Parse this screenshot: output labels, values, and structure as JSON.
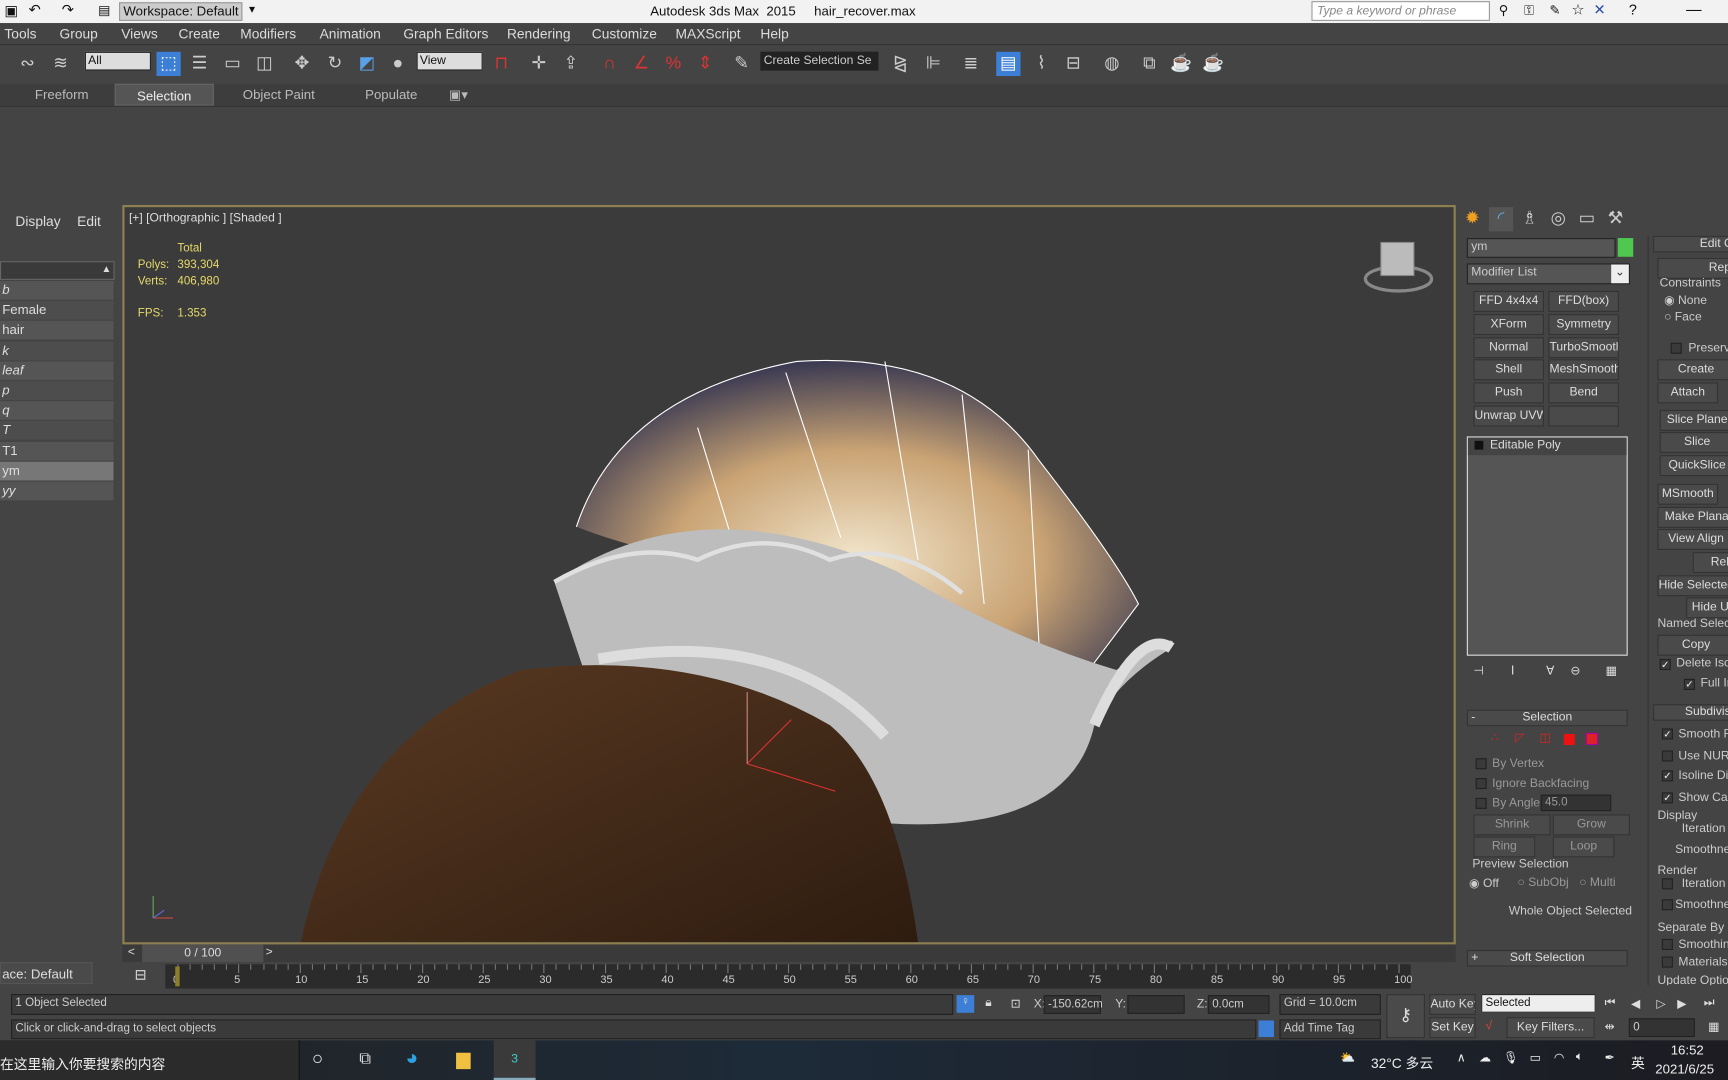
{
  "titlebar": {
    "workspace": "Workspace: Default",
    "title": "Autodesk 3ds Max  2015     hair_recover.max",
    "search_placeholder": "Type a keyword or phrase"
  },
  "menu": [
    "Tools",
    "Group",
    "Views",
    "Create",
    "Modifiers",
    "Animation",
    "Graph Editors",
    "Rendering",
    "Customize",
    "MAXScript",
    "Help"
  ],
  "toolbar": {
    "filter": "All",
    "refcoord": "View",
    "named_selection": "Create Selection Se"
  },
  "ribbon_tabs": [
    "Freeform",
    "Selection",
    "Object Paint",
    "Populate"
  ],
  "explorer": {
    "tabs": [
      "Display",
      "Edit"
    ],
    "items": [
      "b",
      "Female",
      "hair",
      "k",
      "leaf",
      "p",
      "q",
      "T",
      "T1",
      "ym",
      "yy"
    ],
    "selected": "ym",
    "workspace": "ace: Default"
  },
  "viewport": {
    "label": "[+] [Orthographic ] [Shaded ]",
    "stats": {
      "total": "Total",
      "polys_label": "Polys:",
      "polys": "393,304",
      "verts_label": "Verts:",
      "verts": "406,980",
      "fps_label": "FPS:",
      "fps": "1.353"
    }
  },
  "command_panel": {
    "object_name": "ym",
    "object_color": "#4fc84f",
    "modifier_list": "Modifier List",
    "modifier_buttons": [
      "FFD 4x4x4",
      "FFD(box)",
      "XForm",
      "Symmetry",
      "Normal",
      "TurboSmooth",
      "Shell",
      "MeshSmooth",
      "Push",
      "Bend",
      "Unwrap UVW",
      ""
    ],
    "stack": [
      "Editable Poly"
    ],
    "selection": {
      "title": "Selection",
      "by_vertex": "By Vertex",
      "ignore_backfacing": "Ignore Backfacing",
      "by_angle": "By Angle:",
      "angle": "45.0",
      "shrink": "Shrink",
      "grow": "Grow",
      "ring": "Ring",
      "loop": "Loop",
      "preview": "Preview Selection",
      "off": "Off",
      "subobj": "SubObj",
      "multi": "Multi",
      "status": "Whole Object Selected"
    },
    "soft_selection": "Soft Selection",
    "edit_geometry": {
      "title": "Edit Ge",
      "repeat": "Repea",
      "constraints": "Constraints",
      "none": "None",
      "face": "Face",
      "preserve": "Preserve",
      "create": "Create",
      "attach": "Attach",
      "slice_plane": "Slice Plane",
      "slice": "Slice",
      "quickslice": "QuickSlice",
      "msmooth": "MSmooth",
      "make_planar": "Make Planar",
      "view_align": "View Align",
      "relax": "Rela",
      "hide_selected": "Hide Selected",
      "hide_unselected": "Hide Un",
      "named_selections": "Named Selectio",
      "copy": "Copy",
      "delete_isolated": "Delete Isola",
      "full_interactivity": "Full In"
    },
    "subdivision": {
      "title": "Subdivisio",
      "smooth_result": "Smooth Re",
      "use_nurms": "Use NURMS",
      "isoline": "Isoline Disp",
      "show_cage": "Show Cage",
      "display": "Display",
      "iterations": "Iteration",
      "smoothness": "Smoothnes",
      "render": "Render",
      "r_iterations": "Iteration",
      "r_smoothness": "Smoothnes",
      "separate_by": "Separate By",
      "smoothing": "Smoothing",
      "materials": "Materials",
      "update": "Update Option"
    }
  },
  "timeline": {
    "frame": "0 / 100",
    "ticks": [
      "0",
      "5",
      "10",
      "15",
      "20",
      "25",
      "30",
      "35",
      "40",
      "45",
      "50",
      "55",
      "60",
      "65",
      "70",
      "75",
      "80",
      "85",
      "90",
      "95",
      "100"
    ]
  },
  "status": {
    "selected": "1 Object Selected",
    "prompt": "Click or click-and-drag to select objects",
    "x_label": "X:",
    "x": "-150.62cm",
    "y_label": "Y:",
    "y": "",
    "z_label": "Z:",
    "z": "0.0cm",
    "grid": "Grid = 10.0cm",
    "add_time_tag": "Add Time Tag",
    "auto_key": "Auto Key",
    "set_key": "Set Key",
    "key_mode": "Selected",
    "key_filters": "Key Filters...",
    "current_frame": "0"
  },
  "taskbar": {
    "search": "在这里输入你要搜索的内容",
    "weather": "32°C 多云",
    "ime": "英",
    "time": "16:52",
    "date": "2021/6/25"
  }
}
